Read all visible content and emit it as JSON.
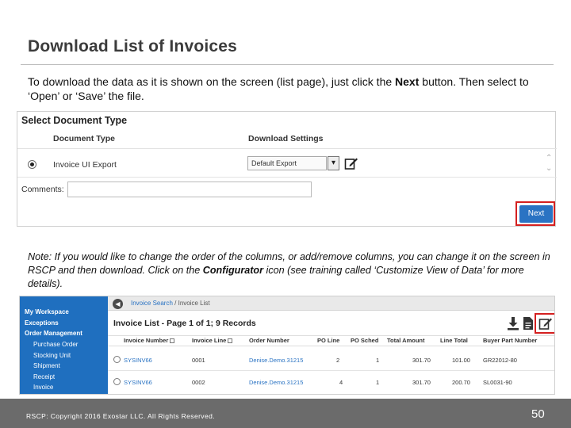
{
  "slide": {
    "title": "Download List of Invoices",
    "intro_pre": "To download the data as it is shown on the screen (list page), just click the ",
    "intro_bold": "Next",
    "intro_post": " button. Then select to ‘Open’ or ‘Save’ the file.",
    "note_pre": "Note:  If you would like to change the order of the columns, or add/remove columns, you can change it on the screen in RSCP and then download.  Click on the ",
    "note_bold": "Configurator",
    "note_post": " icon (see training called ‘Customize View of Data’ for more details)."
  },
  "select_doc": {
    "header": "Select Document Type",
    "col_doc_type": "Document Type",
    "col_download_settings": "Download Settings",
    "row_doc_name": "Invoice UI Export",
    "download_setting_value": "Default Export",
    "comments_label": "Comments:",
    "next_label": "Next"
  },
  "invoice_list": {
    "sidebar": [
      {
        "label": "My Workspace",
        "bold": true
      },
      {
        "label": "Exceptions",
        "bold": true
      },
      {
        "label": "Order Management",
        "bold": true
      },
      {
        "label": "Purchase Order",
        "bold": false
      },
      {
        "label": "Stocking Unit",
        "bold": false
      },
      {
        "label": "Shipment",
        "bold": false
      },
      {
        "label": "Receipt",
        "bold": false
      },
      {
        "label": "Invoice",
        "bold": false
      }
    ],
    "breadcrumb_link": "Invoice Search",
    "breadcrumb_current": " / Invoice List",
    "title": "Invoice List - Page 1 of 1; 9 Records",
    "columns": [
      "Invoice Number",
      "Invoice Line",
      "Order Number",
      "PO Line",
      "PO Sched",
      "Total Amount",
      "Line Total",
      "Buyer Part Number"
    ],
    "rows": [
      {
        "invoice_number": "SYSINV66",
        "invoice_line": "0001",
        "order_number": "Denise.Demo.31215",
        "po_line": "2",
        "po_sched": "1",
        "total_amount": "301.70",
        "line_total": "101.00",
        "buyer_part": "GR22012-80"
      },
      {
        "invoice_number": "SYSINV66",
        "invoice_line": "0002",
        "order_number": "Denise.Demo.31215",
        "po_line": "4",
        "po_sched": "1",
        "total_amount": "301.70",
        "line_total": "200.70",
        "buyer_part": "SL0031-90"
      }
    ]
  },
  "footer": {
    "copyright": "RSCP:  Copyright 2016 Exostar LLC. All Rights Reserved.",
    "page_number": "50"
  },
  "colors": {
    "accent_blue": "#2a73c3",
    "sidebar_blue": "#1f6fbf",
    "highlight_red": "#d42020",
    "footer_gray": "#6b6b6b"
  }
}
